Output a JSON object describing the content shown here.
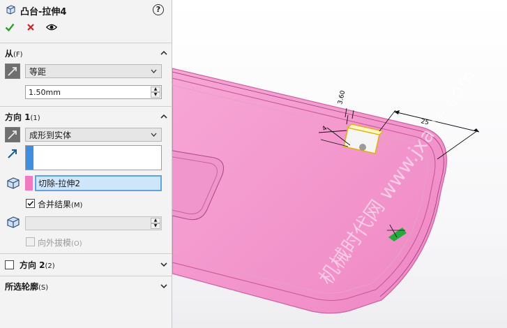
{
  "feature": {
    "title": "凸台-拉伸4",
    "help": "?"
  },
  "icons": {
    "feature": "boss-extrude-icon",
    "help": "help-icon",
    "ok": "check-icon",
    "cancel": "close-icon",
    "preview": "eye-icon"
  },
  "colors": {
    "accent_blue": "#3d8fe0",
    "selection_pink": "#f27ac0",
    "part_pink": "#f49ad0",
    "ok_green": "#2e9e2e",
    "cancel_red": "#d42020"
  },
  "from": {
    "label": "从",
    "shortcut": "(F)",
    "condition": "等距",
    "offset_value": "1.50mm"
  },
  "direction1": {
    "label": "方向 1",
    "shortcut": "(1)",
    "end_condition": "成形到实体",
    "selected_body": "切除-拉伸2",
    "merge_label": "合并结果",
    "merge_shortcut": "(M)",
    "merge_checked": true,
    "draft_label": "向外拔模",
    "draft_shortcut": "(O)",
    "draft_checked": false
  },
  "direction2": {
    "label": "方向 2",
    "shortcut": "(2)",
    "checked": false
  },
  "selected_contours": {
    "label": "所选轮廓",
    "shortcut": "(S)"
  },
  "viewport": {
    "dimensions": [
      "3.60",
      "25",
      "4"
    ],
    "watermark": "机械时代网 www.jxage.com"
  }
}
